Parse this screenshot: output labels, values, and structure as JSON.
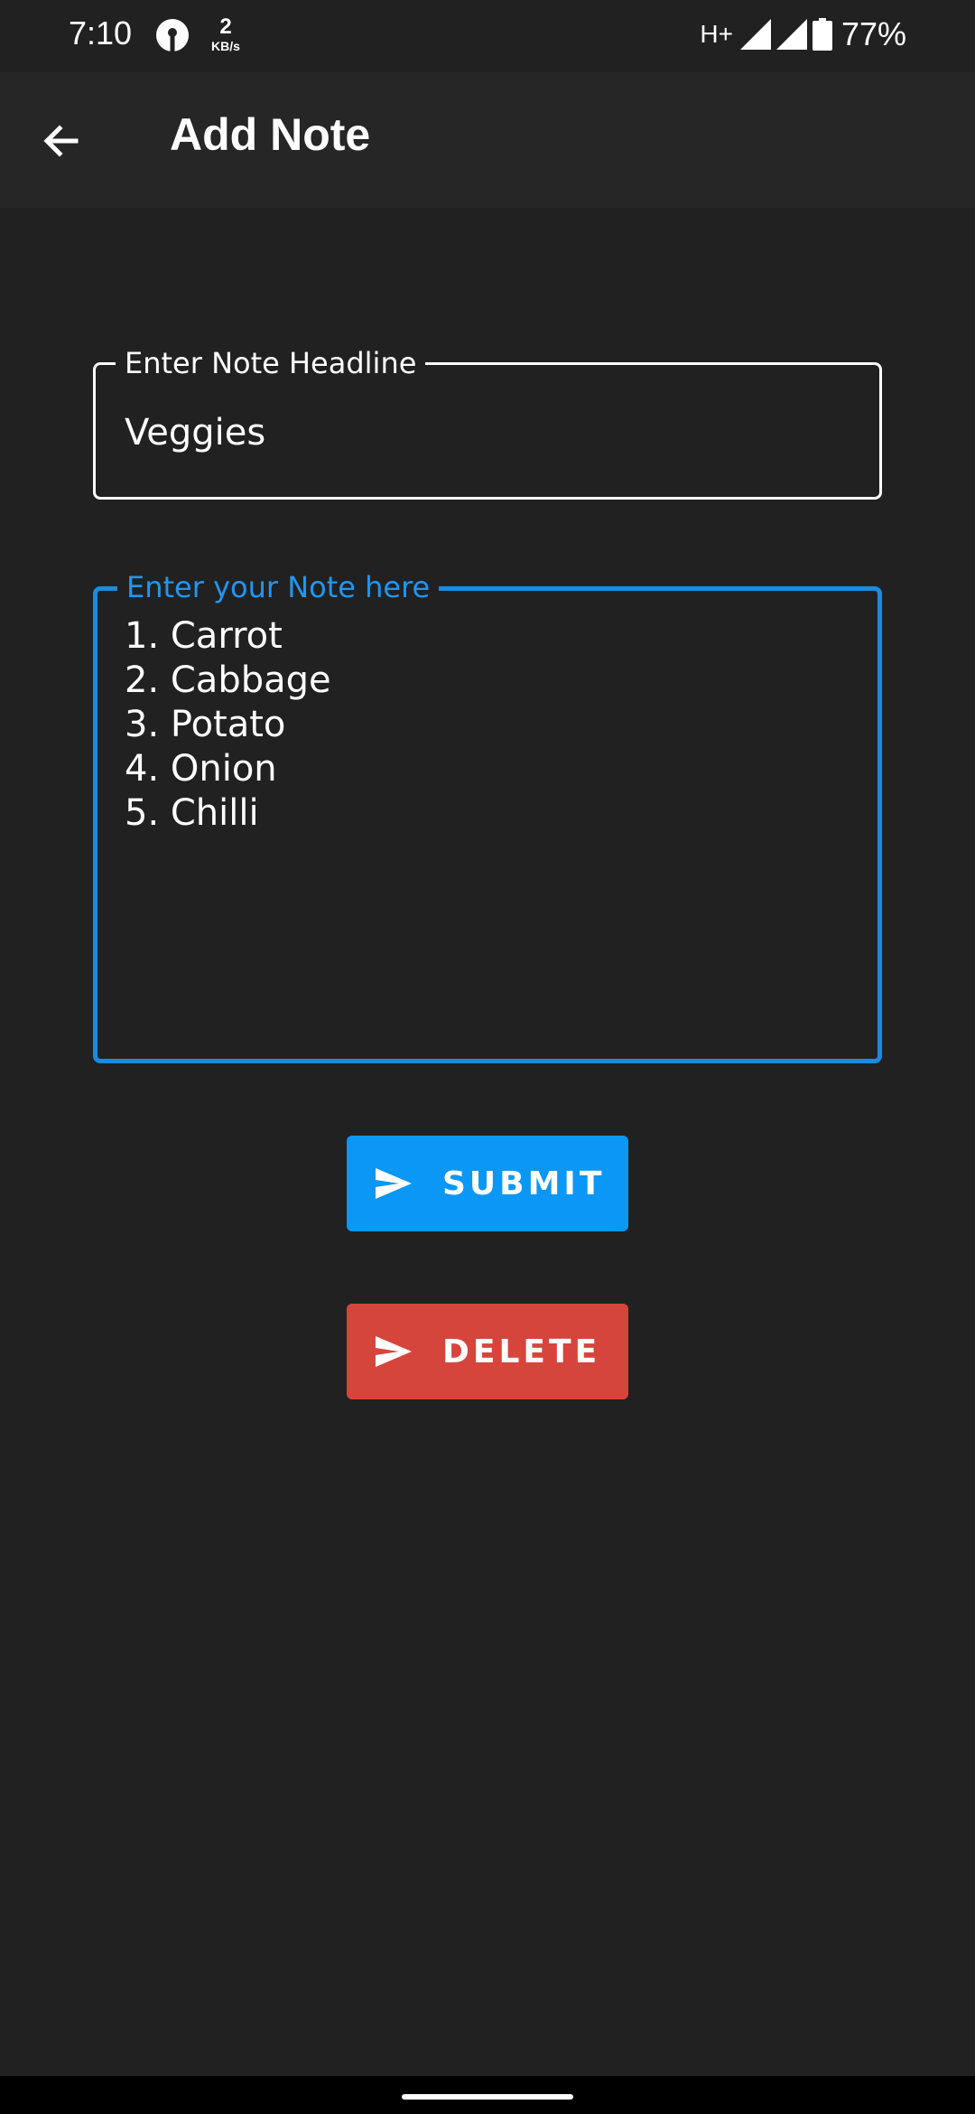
{
  "status_bar": {
    "time": "7:10",
    "speed_value": "2",
    "speed_unit": "KB/s",
    "network_type": "H+",
    "battery_percent": "77%",
    "icons": [
      "sbi-logo-icon",
      "signal-icon",
      "signal-icon",
      "battery-icon"
    ]
  },
  "app_bar": {
    "title": "Add Note",
    "back_icon": "arrow-left-icon"
  },
  "headline_field": {
    "label": "Enter Note Headline",
    "value": "Veggies"
  },
  "note_field": {
    "label": "Enter your Note here",
    "lines": [
      "1. Carrot",
      "2. Cabbage",
      "3. Potato",
      "4. Onion",
      "5. Chilli"
    ]
  },
  "buttons": {
    "submit_label": "SUBMIT",
    "delete_label": "DELETE",
    "icon": "send-icon"
  },
  "colors": {
    "background": "#212121",
    "app_bar": "#262626",
    "focus_accent": "#2196f3",
    "submit": "#0a97f5",
    "delete": "#d6453c"
  }
}
